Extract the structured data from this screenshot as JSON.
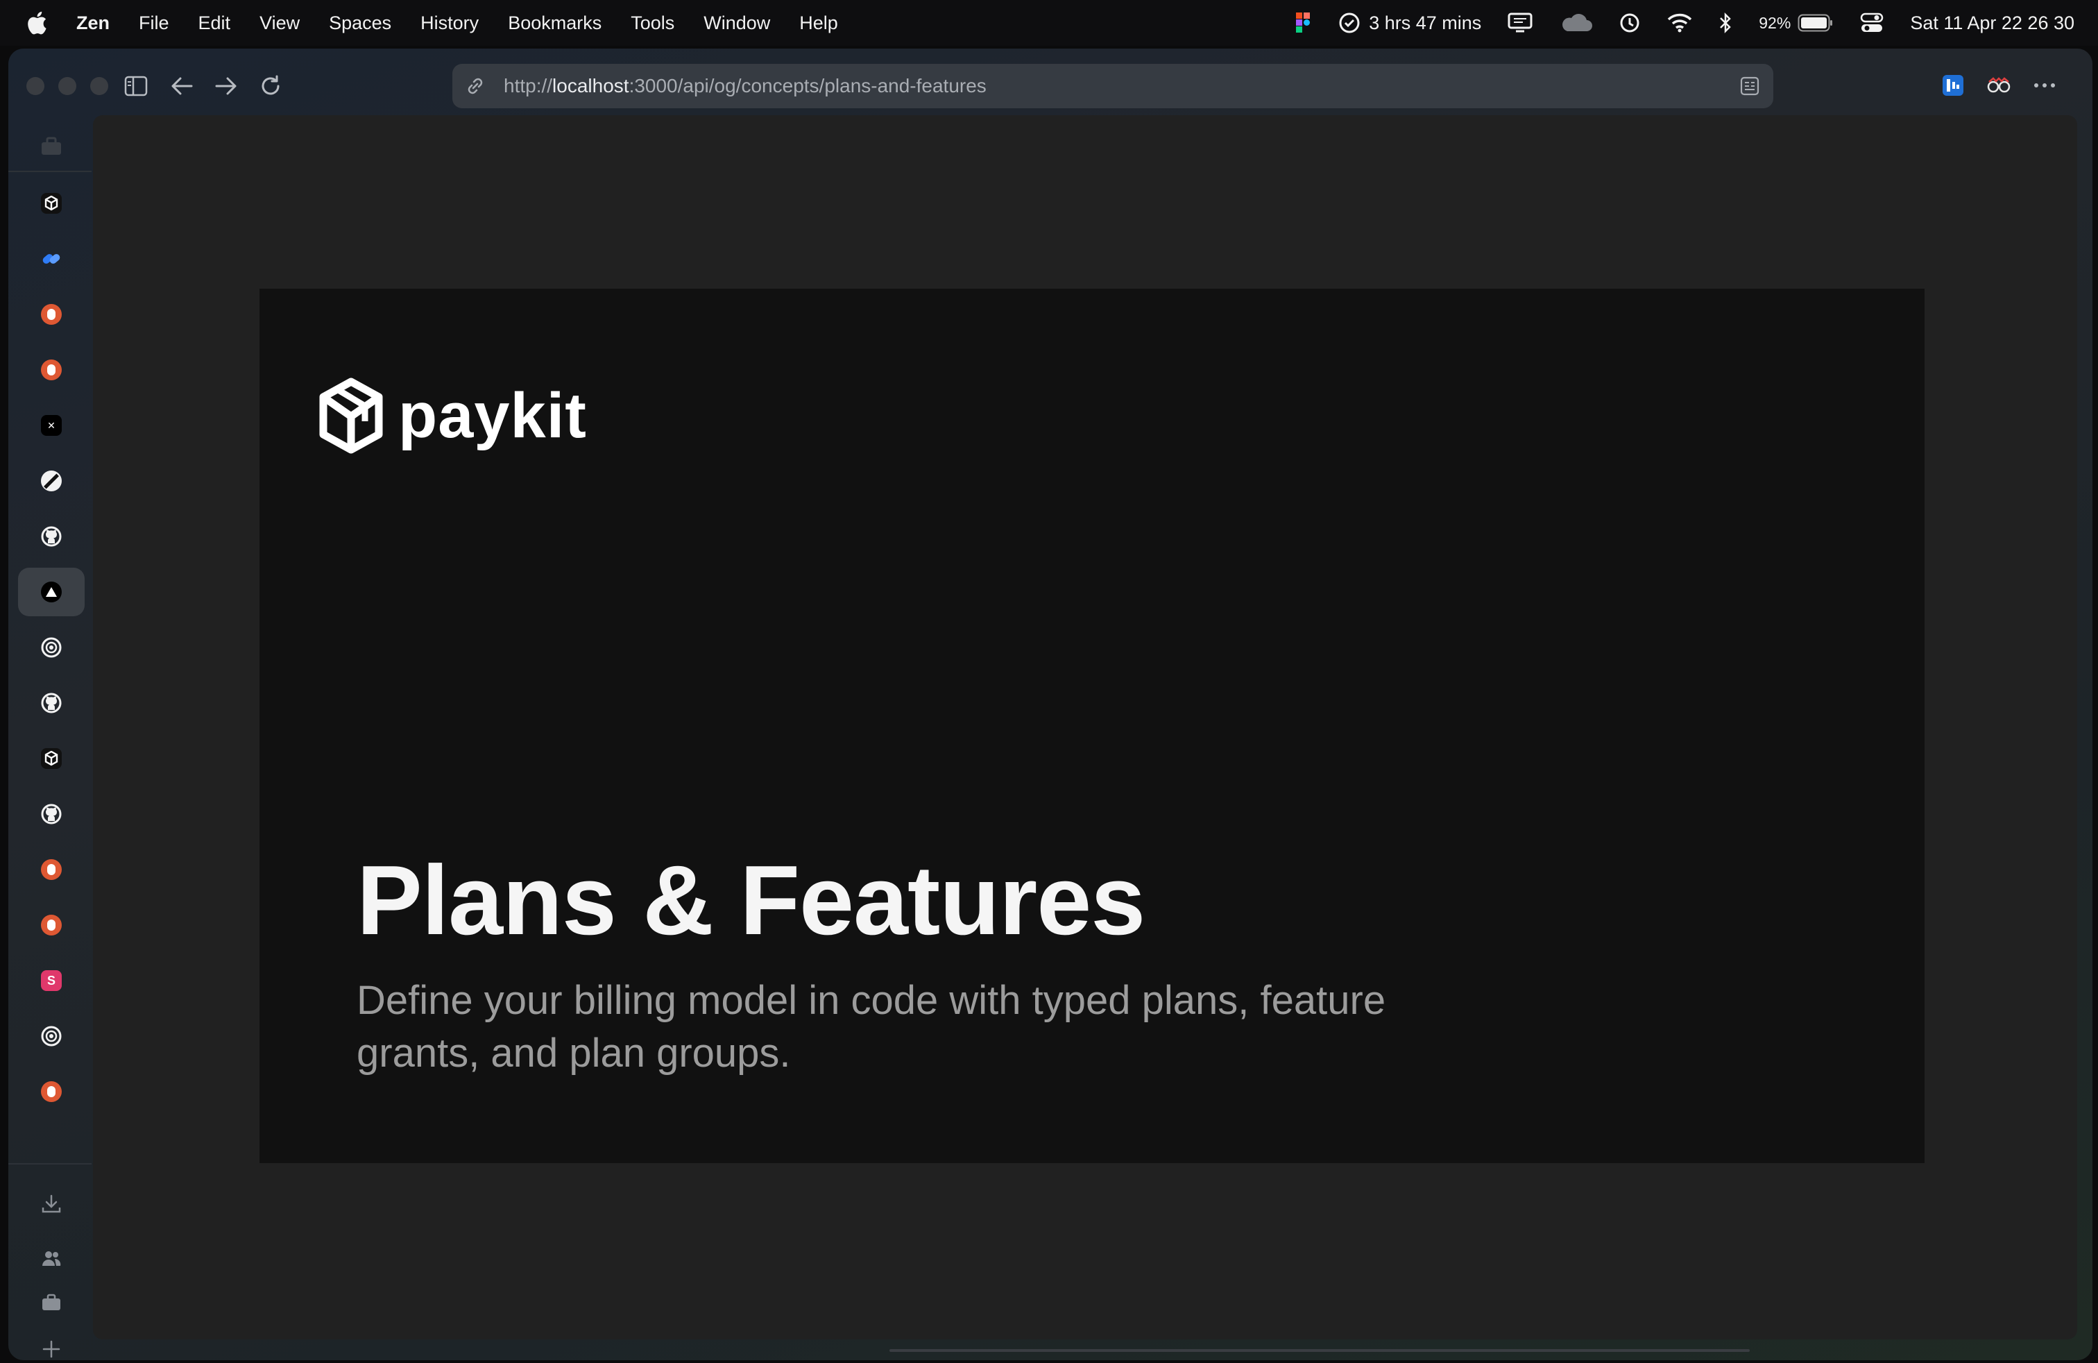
{
  "menubar": {
    "app_name": "Zen",
    "menus": [
      "File",
      "Edit",
      "View",
      "Spaces",
      "History",
      "Bookmarks",
      "Tools",
      "Window",
      "Help"
    ],
    "battery_time": "3 hrs 47 mins",
    "battery_percent": "92%",
    "clock": "Sat 11 Apr  22 26 30"
  },
  "toolbar": {
    "url_scheme": "http://",
    "url_host": "localhost",
    "url_rest": ":3000/api/og/concepts/plans-and-features"
  },
  "sidebar": {
    "items": [
      {
        "icon": "paykit-favicon",
        "color": "#ffffff",
        "bg": "#111111"
      },
      {
        "icon": "link-favicon",
        "color": "#2f7cf6",
        "bg": "transparent"
      },
      {
        "icon": "duckduckgo-favicon",
        "color": "#de5833",
        "bg": "#de5833"
      },
      {
        "icon": "duckduckgo-favicon",
        "color": "#de5833",
        "bg": "#de5833"
      },
      {
        "icon": "x-favicon",
        "color": "#ffffff",
        "bg": "#000000"
      },
      {
        "icon": "stripe-slash-favicon",
        "color": "#ffffff",
        "bg": "#000000"
      },
      {
        "icon": "github-favicon",
        "color": "#ffffff",
        "bg": "transparent"
      },
      {
        "icon": "vercel-favicon",
        "color": "#ffffff",
        "bg": "#000000",
        "active": true
      },
      {
        "icon": "openai-favicon",
        "color": "#ffffff",
        "bg": "transparent"
      },
      {
        "icon": "github-favicon",
        "color": "#ffffff",
        "bg": "transparent"
      },
      {
        "icon": "paykit-favicon",
        "color": "#ffffff",
        "bg": "#111111"
      },
      {
        "icon": "github-favicon",
        "color": "#ffffff",
        "bg": "transparent"
      },
      {
        "icon": "duckduckgo-favicon",
        "color": "#de5833",
        "bg": "#de5833"
      },
      {
        "icon": "duckduckgo-favicon",
        "color": "#de5833",
        "bg": "#de5833"
      },
      {
        "icon": "s-app-favicon",
        "color": "#ffffff",
        "bg": "#e0386b",
        "letter": "S"
      },
      {
        "icon": "openai-favicon",
        "color": "#ffffff",
        "bg": "transparent"
      },
      {
        "icon": "duckduckgo-favicon",
        "color": "#de5833",
        "bg": "#de5833"
      }
    ]
  },
  "page": {
    "brand": "paykit",
    "title": "Plans & Features",
    "description": "Define your billing model in code with typed plans, feature grants, and plan groups."
  },
  "colors": {
    "accent": "#2f7cf6",
    "content_bg": "#212121",
    "card_bg": "#111111"
  }
}
